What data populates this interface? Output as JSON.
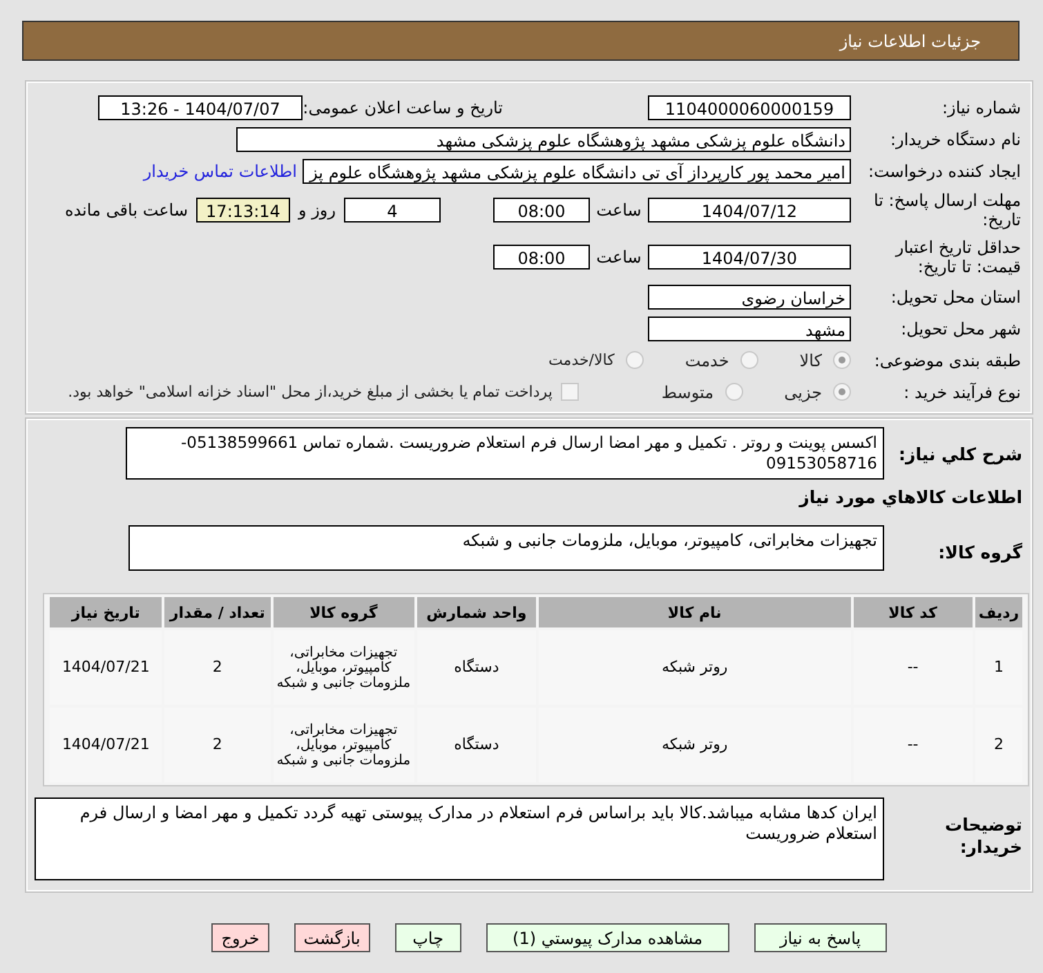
{
  "header": {
    "title": "جزئیات اطلاعات نیاز"
  },
  "need_number": {
    "label": "شماره نیاز:",
    "value": "1104000060000159"
  },
  "announce": {
    "label": "تاریخ و ساعت اعلان عمومی:",
    "value": "1404/07/07 - 13:26"
  },
  "buyer": {
    "label": "نام دستگاه خریدار:",
    "value": "دانشگاه علوم پزشکی مشهد   پژوهشگاه علوم پزشکی مشهد"
  },
  "creator": {
    "label": "ایجاد کننده درخواست:",
    "value": "امیر محمد پور کارپرداز آی تی دانشگاه علوم پزشکی مشهد   پژوهشگاه علوم پز",
    "link": "اطلاعات تماس خریدار"
  },
  "deadline": {
    "label": "مهلت ارسال پاسخ: تا تاریخ:",
    "date": "1404/07/12",
    "time_label": "ساعت",
    "time": "08:00",
    "days": "4",
    "days_label": "روز و",
    "remaining": "17:13:14",
    "remaining_label": "ساعت باقی مانده"
  },
  "validity": {
    "label": "حداقل تاریخ اعتبار قیمت: تا تاریخ:",
    "date": "1404/07/30",
    "time_label": "ساعت",
    "time": "08:00"
  },
  "province": {
    "label": "استان محل تحویل:",
    "value": "خراسان رضوی"
  },
  "city": {
    "label": "شهر محل تحویل:",
    "value": "مشهد"
  },
  "category": {
    "label": "طبقه بندی موضوعی:",
    "options": [
      {
        "label": "کالا",
        "selected": true
      },
      {
        "label": "خدمت",
        "selected": false
      },
      {
        "label": "کالا/خدمت",
        "selected": false
      }
    ]
  },
  "process": {
    "label": "نوع فرآیند خرید :",
    "options": [
      {
        "label": "جزیی",
        "selected": true
      },
      {
        "label": "متوسط",
        "selected": false
      }
    ],
    "treasury": {
      "label": "پرداخت تمام یا بخشی از مبلغ خرید،از محل \"اسناد خزانه اسلامی\" خواهد بود.",
      "checked": false
    }
  },
  "description": {
    "label": "شرح کلي نیاز:",
    "value": "اکسس پوینت و روتر . تکمیل و مهر امضا ارسال فرم استعلام ضروریست .شماره تماس 05138599661-09153058716"
  },
  "items_title": "اطلاعات کالاهاي مورد نياز",
  "goods_group": {
    "label": "گروه کالا:",
    "value": "تجهیزات مخابراتی، کامپیوتر، موبایل، ملزومات جانبی و شبکه"
  },
  "table": {
    "columns": [
      "ردیف",
      "کد کالا",
      "نام کالا",
      "واحد شمارش",
      "گروه کالا",
      "تعداد / مقدار",
      "تاریخ نیاز"
    ],
    "rows": [
      [
        "1",
        "--",
        "روتر شبکه",
        "دستگاه",
        "تجهیزات مخابراتی، کامپیوتر، موبایل، ملزومات جانبی و شبکه",
        "2",
        "1404/07/21"
      ],
      [
        "2",
        "--",
        "روتر شبکه",
        "دستگاه",
        "تجهیزات مخابراتی، کامپیوتر، موبایل، ملزومات جانبی و شبکه",
        "2",
        "1404/07/21"
      ]
    ]
  },
  "buyer_notes": {
    "label": "توضیحات خریدار:",
    "value": "ایران کدها مشابه میباشد.کالا باید براساس فرم استعلام در مدارک پیوستی تهیه گردد تکمیل و مهر امضا و ارسال فرم استعلام ضروریست"
  },
  "buttons": [
    {
      "label": "پاسخ به نیاز",
      "kind": "action"
    },
    {
      "label": "مشاهده مدارک پیوستي (1)",
      "kind": "action"
    },
    {
      "label": "چاپ",
      "kind": "action"
    },
    {
      "label": "بازگشت",
      "kind": "exit"
    },
    {
      "label": "خروج",
      "kind": "exit"
    }
  ]
}
